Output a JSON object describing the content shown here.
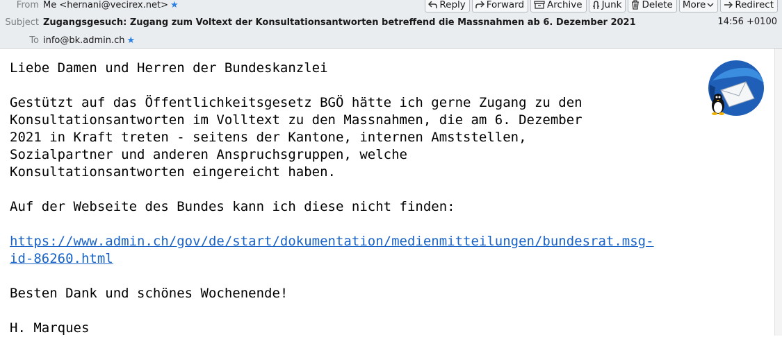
{
  "header": {
    "from_label": "From",
    "from_value": "Me <hernani@vecirex.net>",
    "subject_label": "Subject",
    "subject_value": "Zugangsgesuch: Zugang zum Voltext der Konsultationsantworten betreffend die Massnahmen ab 6. Dezember 2021",
    "to_label": "To",
    "to_value": "info@bk.admin.ch",
    "time": "14:56 +0100"
  },
  "toolbar": {
    "reply": "Reply",
    "forward": "Forward",
    "archive": "Archive",
    "junk": "Junk",
    "delete": "Delete",
    "more": "More",
    "redirect": "Redirect"
  },
  "body": {
    "greeting": "Liebe Damen und Herren der Bundeskanzlei",
    "p1_l1": "Gestützt auf das Öffentlichkeitsgesetz BGÖ hätte ich gerne Zugang zu den",
    "p1_l2": "Konsultationsantworten im Volltext zu den Massnahmen, die am 6. Dezember",
    "p1_l3": "2021 in Kraft treten - seitens der Kantone, internen Amststellen,",
    "p1_l4": "Sozialpartner und anderen Anspruchsgruppen, welche",
    "p1_l5": "Konsultationsantworten eingereicht haben.",
    "p2": "Auf der Webseite des Bundes kann ich diese nicht finden:",
    "link_l1": "https://www.admin.ch/gov/de/start/dokumentation/medienmitteilungen/bundesrat.msg-",
    "link_l2": "id-86260.html",
    "closing": "Besten Dank und schönes Wochenende!",
    "signature": "H. Marques"
  },
  "colors": {
    "header_bg": "#eaedf0",
    "link": "#1a63c6",
    "star": "#2a7fe0"
  },
  "icons": [
    "reply-icon",
    "forward-icon",
    "archive-icon",
    "junk-icon",
    "delete-icon",
    "chevron-down-icon",
    "redirect-icon",
    "star-icon",
    "thunderbird-logo"
  ]
}
